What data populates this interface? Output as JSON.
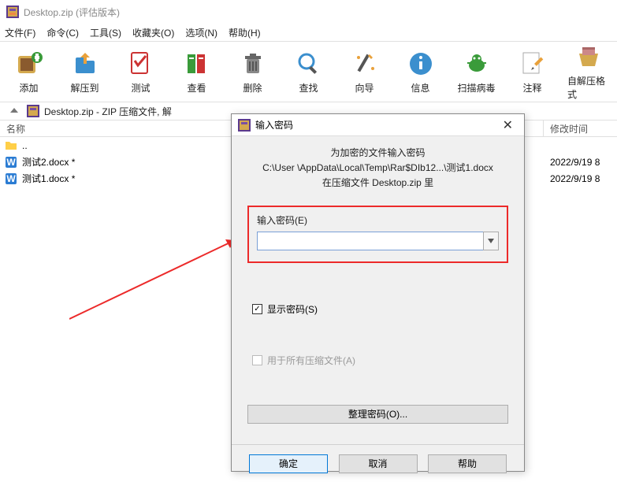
{
  "title": "Desktop.zip (评估版本)",
  "menu": [
    "文件(F)",
    "命令(C)",
    "工具(S)",
    "收藏夹(O)",
    "选项(N)",
    "帮助(H)"
  ],
  "tools": [
    "添加",
    "解压到",
    "测试",
    "查看",
    "删除",
    "查找",
    "向导",
    "信息",
    "扫描病毒",
    "注释",
    "自解压格式"
  ],
  "path": "Desktop.zip - ZIP 压缩文件, 解",
  "cols": {
    "name": "名称",
    "time": "修改时间"
  },
  "files": [
    {
      "name": "..",
      "type": "folder",
      "time": ""
    },
    {
      "name": "测试2.docx *",
      "type": "docx",
      "time": "2022/9/19 8"
    },
    {
      "name": "测试1.docx *",
      "type": "docx",
      "time": "2022/9/19 8"
    }
  ],
  "dlg": {
    "title": "输入密码",
    "msg1": "为加密的文件输入密码",
    "msg2": "C:\\User                \\AppData\\Local\\Temp\\Rar$DIb12...\\测试1.docx",
    "msg3": "在压缩文件 Desktop.zip 里",
    "input_label": "输入密码(E)",
    "show_pwd": "显示密码(S)",
    "all_files": "用于所有压缩文件(A)",
    "organize": "整理密码(O)...",
    "ok": "确定",
    "cancel": "取消",
    "help": "帮助"
  }
}
